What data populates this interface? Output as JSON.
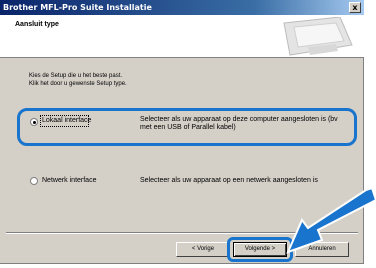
{
  "window": {
    "title": "Brother MFL-Pro Suite Installatie",
    "close_label": "x"
  },
  "header": {
    "title": "Aansluit type"
  },
  "intro": {
    "line1": "Kies de Setup die u het beste past.",
    "line2": "Klik het door u gewenste Setup type."
  },
  "options": [
    {
      "label": "Lokaal interface",
      "desc_line1": "Selecteer als uw apparaat op deze computer aangesloten is (bv",
      "desc_line2": "met een USB of Parallel kabel)",
      "selected": true
    },
    {
      "label": "Netwerk interface",
      "desc_line1": "Selecteer als uw apparaat op een netwerk aangesloten is",
      "selected": false
    }
  ],
  "buttons": {
    "back": "< Vorige",
    "next": "Volgende >",
    "cancel": "Annuleren"
  },
  "colors": {
    "highlight": "#1874cd",
    "title_bar": "#0a246a"
  }
}
